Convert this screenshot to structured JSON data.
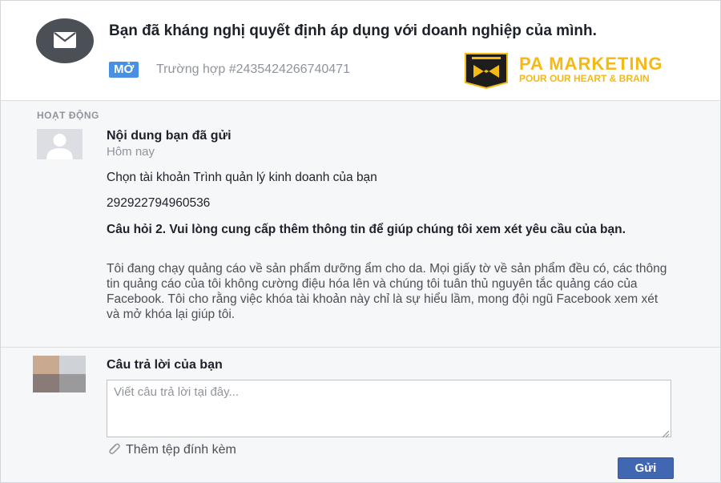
{
  "header": {
    "title": "Bạn đã kháng nghị quyết định áp dụng với doanh nghiệp của mình.",
    "status_badge": "MỞ",
    "case_label": "Trường hợp #2435424266740471"
  },
  "logo": {
    "brand": "PA MARKETING",
    "tagline": "POUR OUR HEART & BRAIN",
    "color": "#f5b916"
  },
  "activity": {
    "section_label": "HOẠT ĐỘNG",
    "sender_title": "Nội dung bạn đã gửi",
    "sender_time": "Hôm nay",
    "question1": "Chọn tài khoản Trình quản lý kinh doanh của bạn",
    "question1_value": "292922794960536",
    "question2": "Câu hỏi 2. Vui lòng cung cấp thêm thông tin để giúp chúng tôi xem xét yêu cầu của bạn.",
    "question2_value": "Tôi đang chạy quảng cáo về sản phẩm dưỡng ẩm cho da. Mọi giấy tờ về sản phẩm đều có, các thông tin quảng cáo của tôi không cường điệu hóa lên và chúng tôi tuân thủ nguyên tắc quảng cáo của Facebook. Tôi cho rằng việc khóa tài khoản này chỉ là sự hiểu lầm, mong đội ngũ Facebook xem xét và mở khóa lại giúp tôi."
  },
  "reply": {
    "title": "Câu trả lời của bạn",
    "placeholder": "Viết câu trả lời tại đây...",
    "value": "",
    "attach_label": "Thêm tệp đính kèm",
    "send_label": "Gửi"
  },
  "colors": {
    "accent": "#4267b2",
    "badge": "#4a90e2",
    "muted_text": "#90949c"
  },
  "icons": [
    "mail-icon",
    "attachment-icon",
    "resize-grip-icon"
  ]
}
